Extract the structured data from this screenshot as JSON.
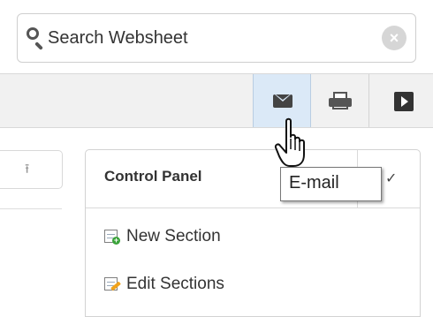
{
  "search": {
    "placeholder": "Search Websheet",
    "clear_icon": "clear-icon"
  },
  "toolbar": {
    "buttons": [
      {
        "name": "email-button",
        "icon": "envelope-icon"
      },
      {
        "name": "print-button",
        "icon": "printer-icon"
      },
      {
        "name": "present-button",
        "icon": "play-icon"
      }
    ]
  },
  "left_panel": {
    "icon": "upload-icon",
    "glyph": "⭱"
  },
  "control_panel": {
    "title": "Control Panel",
    "items": [
      {
        "label": "New Section",
        "icon": "new-section-icon"
      },
      {
        "label": "Edit Sections",
        "icon": "edit-sections-icon"
      }
    ],
    "chevron": "✓"
  },
  "tooltip": {
    "text": "E-mail"
  },
  "colors": {
    "toolbar_bg": "#f1f1f1",
    "active_button_bg": "#dbe9f7"
  }
}
